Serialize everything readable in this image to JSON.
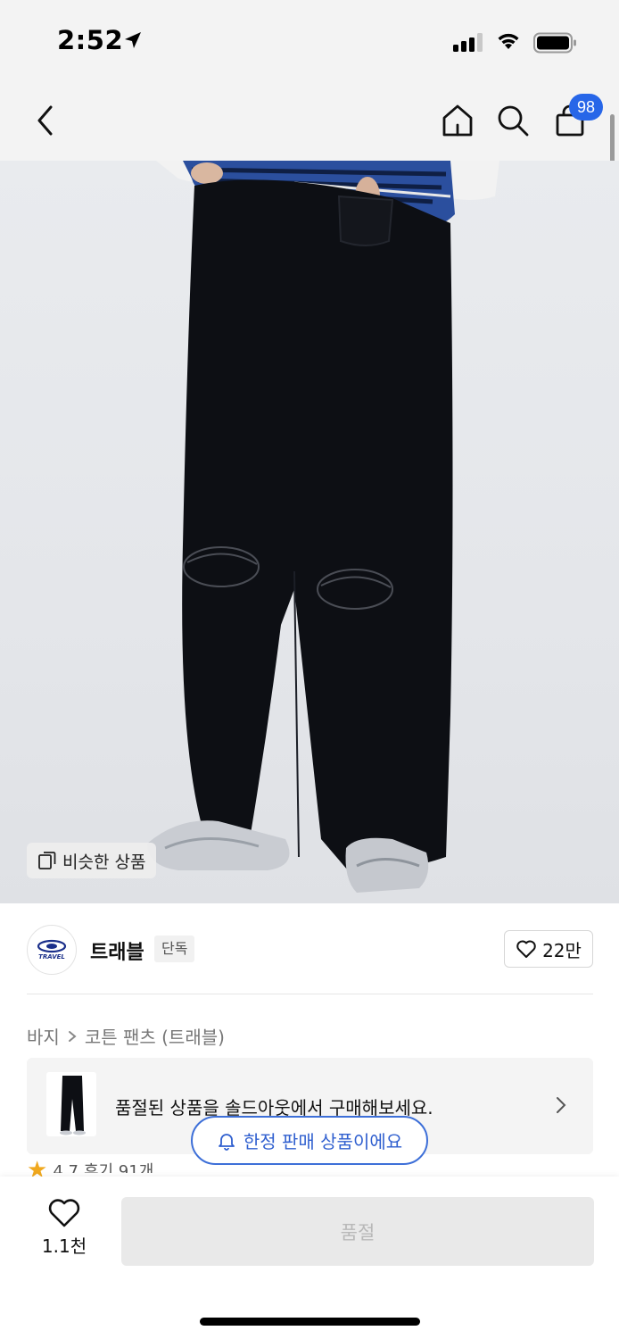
{
  "status_bar": {
    "time": "2:52",
    "signal_level": "3 of 4 bars"
  },
  "nav": {
    "back_icon": "chevron-left-icon",
    "home_icon": "home-icon",
    "search_icon": "search-icon",
    "cart_icon": "shopping-bag-icon",
    "cart_badge": "98",
    "badge_color": "#2766e8"
  },
  "product_image": {
    "similar_products_label": "비슷한 상품",
    "similar_icon": "copy-icon"
  },
  "brand": {
    "logo_text": "TRAVEL",
    "name": "트래블",
    "exclusive_tag": "단독",
    "like_count": "22만"
  },
  "breadcrumb": {
    "category": "바지",
    "product": "코튼 팬츠 (트래블)"
  },
  "soldout_banner": {
    "text": "품절된 상품을 솔드아웃에서 구매해보세요."
  },
  "rating": {
    "score": "4.7",
    "reviews": "후기 91개"
  },
  "limited_pill": {
    "label": "한정 판매 상품이에요",
    "accent": "#3d6fd8"
  },
  "bottom_bar": {
    "like_count": "1.1천",
    "buy_label": "품절"
  }
}
